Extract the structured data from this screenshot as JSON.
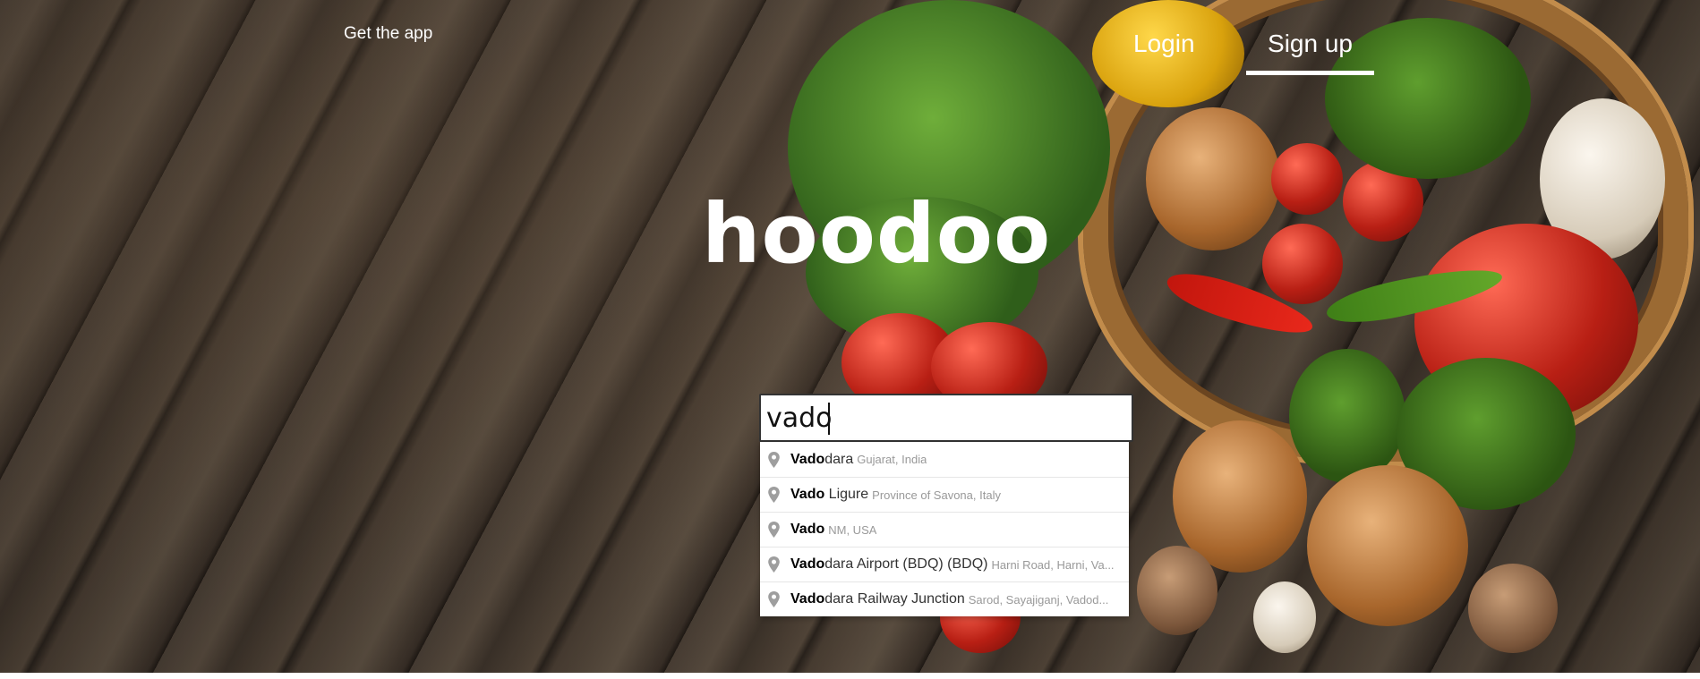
{
  "nav": {
    "get_app": "Get the app",
    "login": "Login",
    "signup": "Sign up"
  },
  "brand": {
    "logo_text": "hoodoo"
  },
  "search": {
    "value": "vado",
    "suggestions": [
      {
        "match": "Vado",
        "rest": "dara",
        "secondary": "Gujarat, India"
      },
      {
        "match": "Vado",
        "rest": " Ligure",
        "secondary": "Province of Savona, Italy"
      },
      {
        "match": "Vado",
        "rest": "",
        "secondary": "NM, USA"
      },
      {
        "match": "Vado",
        "rest": "dara Airport (BDQ) (BDQ)",
        "secondary": "Harni Road, Harni, Va..."
      },
      {
        "match": "Vado",
        "rest": "dara Railway Junction",
        "secondary": "Sarod, Sayajiganj, Vadod..."
      }
    ]
  },
  "colors": {
    "text_light": "#ffffff",
    "secondary_text": "#999999",
    "pin_icon": "#9e9e9e"
  },
  "icons": {
    "suggestion_icon": "map-pin-icon"
  }
}
